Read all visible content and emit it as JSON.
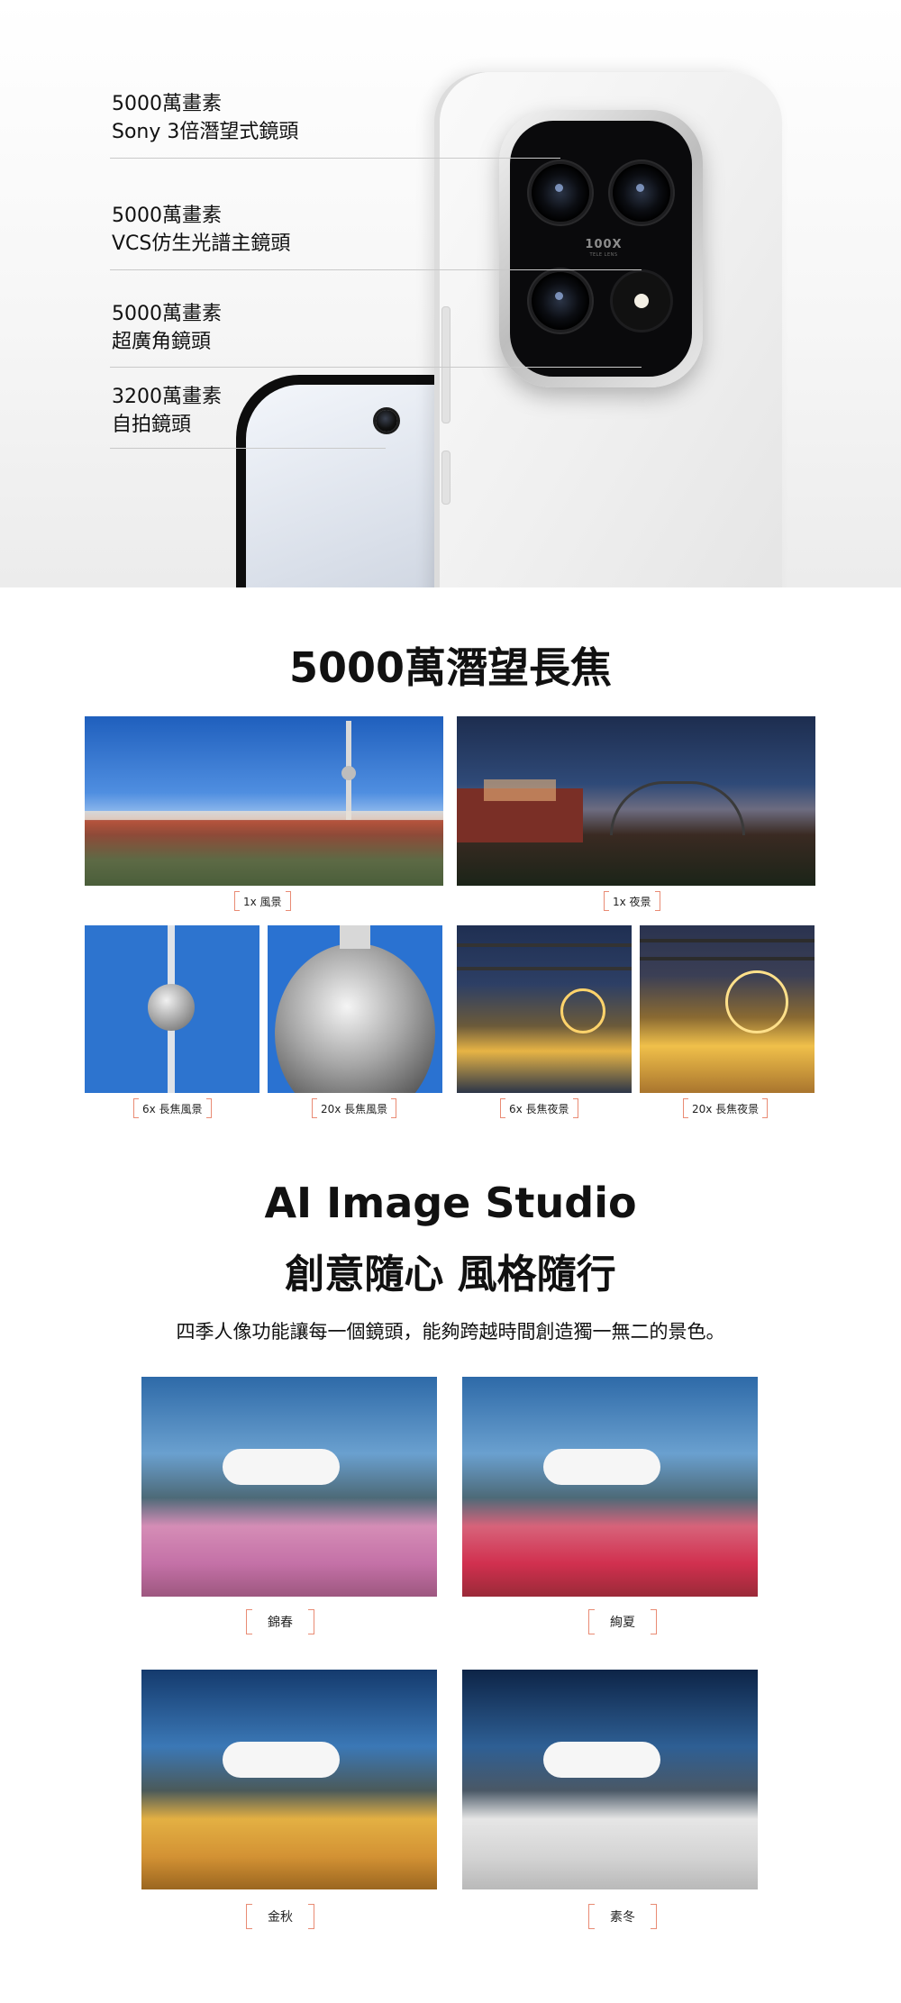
{
  "hero": {
    "specs": [
      {
        "line1": "5000萬畫素",
        "line2": "Sony 3倍潛望式鏡頭"
      },
      {
        "line1": "5000萬畫素",
        "line2": "VCS仿生光譜主鏡頭"
      },
      {
        "line1": "5000萬畫素",
        "line2": "超廣角鏡頭"
      },
      {
        "line1": "3200萬畫素",
        "line2": "自拍鏡頭"
      }
    ],
    "camera_badge": "100X",
    "camera_badge_sub": "TELE LENS"
  },
  "telephoto": {
    "title": "5000萬潛望長焦",
    "captions": [
      "1x 風景",
      "1x 夜景",
      "6x 長焦風景",
      "20x 長焦風景",
      "6x 長焦夜景",
      "20x 長焦夜景"
    ]
  },
  "ai_studio": {
    "title_line1": "AI Image Studio",
    "title_line2": "創意隨心 風格隨行",
    "description": "四季人像功能讓每一個鏡頭，能夠跨越時間創造獨一無二的景色。",
    "seasons": [
      "錦春",
      "絢夏",
      "金秋",
      "素冬"
    ]
  },
  "colors": {
    "accent_bracket": "#e98b74",
    "sky_blue": "#2f73c9",
    "night_blue": "#1d2d4f"
  }
}
